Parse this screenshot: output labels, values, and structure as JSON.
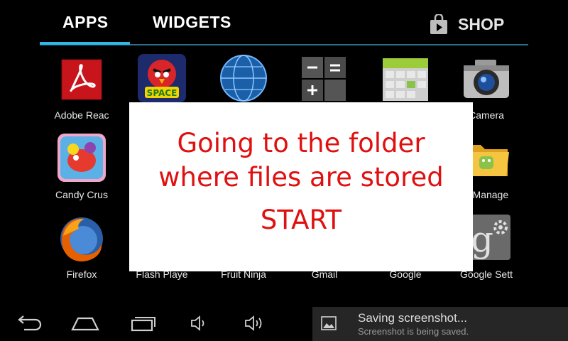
{
  "tabs": {
    "apps_label": "APPS",
    "widgets_label": "WIDGETS",
    "shop_label": "SHOP",
    "active": "APPS",
    "accent_color": "#33b5e5"
  },
  "apps": [
    {
      "label": "Adobe Reac",
      "icon": "adobe-reader-icon"
    },
    {
      "label": "",
      "icon": "angry-birds-space-icon"
    },
    {
      "label": "",
      "icon": "browser-globe-icon"
    },
    {
      "label": "",
      "icon": "calculator-icon"
    },
    {
      "label": "",
      "icon": "calendar-icon"
    },
    {
      "label": "Camera",
      "icon": "camera-icon"
    },
    {
      "label": "Candy Crus",
      "icon": "candy-crush-icon"
    },
    {
      "label": "e Manage",
      "icon": "file-manager-icon"
    },
    {
      "label": "Firefox",
      "icon": "firefox-icon"
    },
    {
      "label": "Flash Playe",
      "icon": "flash-player-icon"
    },
    {
      "label": "Fruit Ninja",
      "icon": "fruit-ninja-icon"
    },
    {
      "label": "Gmail",
      "icon": "gmail-icon"
    },
    {
      "label": "Google",
      "icon": "google-icon"
    },
    {
      "label": "Google Sett",
      "icon": "google-settings-icon"
    }
  ],
  "overlay": {
    "line1": "Going to the folder",
    "line2": "where files are stored",
    "start": "START",
    "text_color": "#e01010"
  },
  "navbar": {
    "buttons": [
      "back-icon",
      "home-icon",
      "recent-apps-icon",
      "volume-down-icon",
      "volume-up-icon"
    ]
  },
  "notification": {
    "title": "Saving screenshot...",
    "subtitle": "Screenshot is being saved.",
    "icon": "image-icon"
  }
}
